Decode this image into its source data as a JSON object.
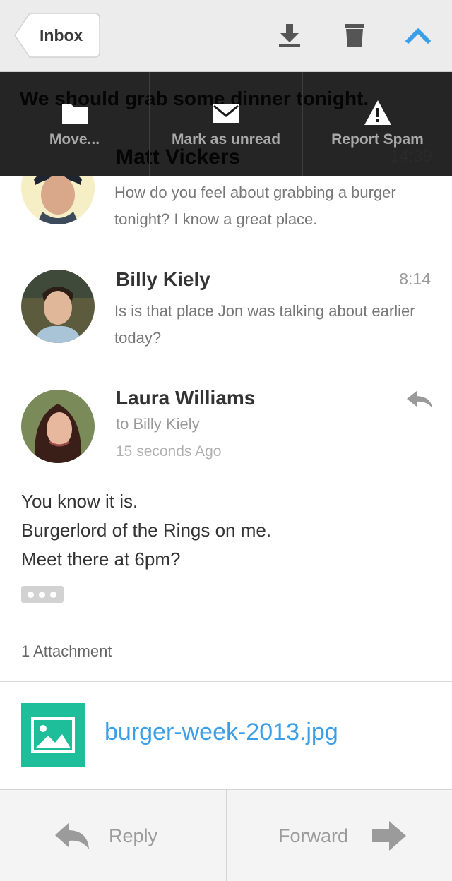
{
  "nav": {
    "back_label": "Inbox",
    "actions": [
      "download",
      "trash",
      "collapse"
    ],
    "accent_color": "#3a9ee8"
  },
  "overlay": {
    "background_subject": "We should grab some dinner tonight.",
    "background_sender": "Matt Vickers",
    "background_time": "14:39",
    "actions": [
      {
        "label": "Move...",
        "icon": "folder-icon"
      },
      {
        "label": "Mark as unread",
        "icon": "envelope-icon"
      },
      {
        "label": "Report Spam",
        "icon": "warning-icon"
      }
    ]
  },
  "messages": [
    {
      "sender": "Matt Vickers",
      "time": "14:39",
      "snippet": "How do you feel about grabbing a burger tonight? I know a great place."
    },
    {
      "sender": "Billy Kiely",
      "time": "8:14",
      "snippet": "Is is that place Jon was talking about earlier today?"
    },
    {
      "sender": "Laura Williams",
      "to": "to Billy Kiely",
      "ago": "15 seconds Ago",
      "body": [
        "You know it is.",
        "Burgerlord of the Rings on me.",
        "Meet there at 6pm?"
      ]
    }
  ],
  "attachments": {
    "count_label": "1 Attachment",
    "files": [
      {
        "name": "burger-week-2013.jpg",
        "icon": "image-icon",
        "tile_color": "#1fbe9a"
      }
    ]
  },
  "toolbar": {
    "reply_label": "Reply",
    "forward_label": "Forward"
  }
}
